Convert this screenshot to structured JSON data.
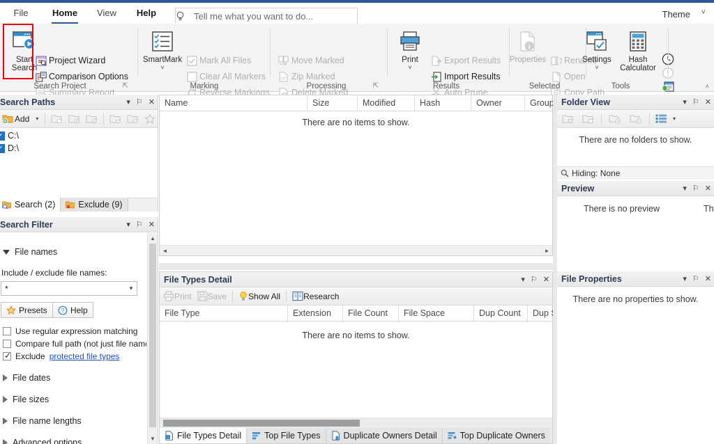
{
  "window": {
    "accent": "#2b579a",
    "highlight_color": "#e8000d"
  },
  "ribbon": {
    "tabs": [
      {
        "label": "File",
        "state": "normal"
      },
      {
        "label": "Home",
        "state": "active"
      },
      {
        "label": "View",
        "state": "normal"
      },
      {
        "label": "Help",
        "state": "bold"
      }
    ],
    "tellme": {
      "placeholder": "Tell me what you want to do...",
      "icon": "lightbulb-icon"
    },
    "theme_label": "Theme",
    "groups": [
      {
        "name": "Search Project",
        "label": "Search Project",
        "has_launcher": true,
        "big": [
          {
            "label_line1": "Start",
            "label_line2": "Search",
            "enabled": true,
            "icon": "start-search-icon"
          }
        ],
        "small": [
          {
            "label": "Project Wizard",
            "enabled": true,
            "icon": "project-wizard-icon"
          },
          {
            "label": "Comparison Options",
            "enabled": true,
            "icon": "comparison-options-icon"
          },
          {
            "label": "Summary Report",
            "enabled": false,
            "icon": "summary-report-icon"
          }
        ]
      },
      {
        "name": "Marking",
        "label": "Marking",
        "has_launcher": false,
        "big": [
          {
            "label_line1": "SmartMark",
            "label_line2": "",
            "enabled": true,
            "icon": "smartmark-icon",
            "dropdown": true
          }
        ],
        "small": [
          {
            "label": "Mark All Files",
            "enabled": false,
            "icon": "mark-all-files-icon"
          },
          {
            "label": "Clear All Markers",
            "enabled": false,
            "icon": "clear-all-markers-icon"
          },
          {
            "label": "Reverse Markings",
            "enabled": false,
            "icon": "reverse-markings-icon"
          }
        ]
      },
      {
        "name": "Processing",
        "label": "Processing",
        "has_launcher": true,
        "big": [],
        "small": [
          {
            "label": "Move Marked",
            "enabled": false,
            "icon": "move-marked-icon"
          },
          {
            "label": "Zip Marked",
            "enabled": false,
            "icon": "zip-marked-icon"
          },
          {
            "label": "Delete Marked",
            "enabled": false,
            "icon": "delete-marked-icon"
          }
        ]
      },
      {
        "name": "Results",
        "label": "Results",
        "has_launcher": false,
        "big": [
          {
            "label_line1": "Print",
            "label_line2": "",
            "enabled": true,
            "icon": "print-icon",
            "dropdown": true
          }
        ],
        "small": [
          {
            "label": "Export Results",
            "enabled": false,
            "icon": "export-results-icon"
          },
          {
            "label": "Import Results",
            "enabled": true,
            "icon": "import-results-icon"
          },
          {
            "label": "Auto Prune",
            "enabled": false,
            "icon": "auto-prune-icon"
          }
        ]
      },
      {
        "name": "Selected",
        "label": "Selected",
        "has_launcher": false,
        "big": [
          {
            "label_line1": "Properties",
            "label_line2": "",
            "enabled": false,
            "icon": "properties-icon"
          }
        ],
        "small": [
          {
            "label": "Rename",
            "enabled": false,
            "icon": "rename-icon"
          },
          {
            "label": "Open",
            "enabled": false,
            "icon": "open-icon"
          },
          {
            "label": "Copy Path",
            "enabled": false,
            "icon": "copy-path-icon"
          }
        ]
      },
      {
        "name": "Tools",
        "label": "Tools",
        "has_launcher": false,
        "big": [
          {
            "label_line1": "Settings",
            "label_line2": "",
            "enabled": true,
            "icon": "settings-icon",
            "dropdown": true
          },
          {
            "label_line1": "Hash",
            "label_line2": "Calculator",
            "enabled": true,
            "icon": "hash-calculator-icon"
          }
        ],
        "small": [
          {
            "label": "",
            "enabled": true,
            "icon": "clock-icon"
          },
          {
            "label": "",
            "enabled": false,
            "icon": "alert-icon"
          },
          {
            "label": "",
            "enabled": true,
            "icon": "security-report-icon"
          }
        ]
      }
    ]
  },
  "search_paths": {
    "title": "Search Paths",
    "toolbar": {
      "add_label": "Add",
      "add_icon": "add-folder-icon",
      "add_dropdown": true,
      "buttons": [
        {
          "icon": "folder-check-icon",
          "enabled": false
        },
        {
          "icon": "folder-add-icon",
          "enabled": false
        },
        {
          "icon": "folder-down-icon",
          "enabled": false
        },
        {
          "icon": "folder-lock-icon",
          "enabled": false
        },
        {
          "icon": "folder-remove-icon",
          "enabled": false
        },
        {
          "icon": "star-icon",
          "enabled": false
        }
      ]
    },
    "paths": [
      {
        "label": "C:\\",
        "checked": true
      },
      {
        "label": "D:\\",
        "checked": true
      }
    ],
    "tabs": [
      {
        "label": "Search (2)",
        "icon": "search-folder-icon",
        "selected": true
      },
      {
        "label": "Exclude (9)",
        "icon": "exclude-folder-icon",
        "selected": false
      }
    ]
  },
  "search_filter": {
    "title": "Search Filter",
    "sections": [
      {
        "label": "File names",
        "expanded": true
      },
      {
        "label": "File dates",
        "expanded": false
      },
      {
        "label": "File sizes",
        "expanded": false
      },
      {
        "label": "File name lengths",
        "expanded": false
      },
      {
        "label": "Advanced options",
        "expanded": false
      }
    ],
    "include_exclude_label": "Include / exclude file names:",
    "pattern_value": "*",
    "presets_label": "Presets",
    "presets_icon": "star-icon",
    "help_label": "Help",
    "help_icon": "question-icon",
    "checkboxes": [
      {
        "label": "Use regular expression matching",
        "checked": false
      },
      {
        "label": "Compare full path (not just file name)",
        "checked": false
      },
      {
        "label": "Exclude ",
        "link": "protected file types",
        "checked": true
      }
    ]
  },
  "file_list": {
    "columns": [
      "Name",
      "Size",
      "Modified",
      "Hash",
      "Owner",
      "Group"
    ],
    "empty_message": "There are no items to show.",
    "rows": []
  },
  "file_types_detail": {
    "title": "File Types Detail",
    "toolbar": [
      {
        "label": "Print",
        "enabled": false,
        "icon": "print-icon"
      },
      {
        "label": "Save",
        "enabled": false,
        "icon": "save-icon"
      },
      {
        "label": "Show All",
        "enabled": true,
        "icon": "lightbulb-icon"
      },
      {
        "label": "Research",
        "enabled": true,
        "icon": "research-icon"
      }
    ],
    "columns": [
      "File Type",
      "Extension",
      "File Count",
      "File Space",
      "Dup Count",
      "Dup S"
    ],
    "empty_message": "There are no items to show.",
    "rows": [],
    "tabs": [
      {
        "label": "File Types Detail",
        "icon": "file-types-detail-icon",
        "selected": true
      },
      {
        "label": "Top File Types",
        "icon": "top-file-types-icon",
        "selected": false
      },
      {
        "label": "Duplicate Owners Detail",
        "icon": "duplicate-owners-detail-icon",
        "selected": false
      },
      {
        "label": "Top Duplicate Owners",
        "icon": "top-duplicate-owners-icon",
        "selected": false
      }
    ]
  },
  "folder_view": {
    "title": "Folder View",
    "toolbar": [
      {
        "icon": "folder-check-icon",
        "enabled": false
      },
      {
        "icon": "folder-blank-icon",
        "enabled": false
      },
      {
        "icon": "folder-expand-icon",
        "enabled": false
      },
      {
        "icon": "folder-collapse-icon",
        "enabled": false
      },
      {
        "icon": "tree-view-icon",
        "enabled": true,
        "dropdown": true
      }
    ],
    "empty_message": "There are no folders to show.",
    "status": "Hiding: None",
    "status_icon": "magnifier-icon"
  },
  "preview": {
    "title": "Preview",
    "empty_message": "There is no preview",
    "empty_message_clipped": "Th"
  },
  "file_properties": {
    "title": "File Properties",
    "empty_message": "There are no properties to show."
  },
  "panel_actions": {
    "dropdown": "▾",
    "pin": "⚐",
    "close": "✕"
  }
}
